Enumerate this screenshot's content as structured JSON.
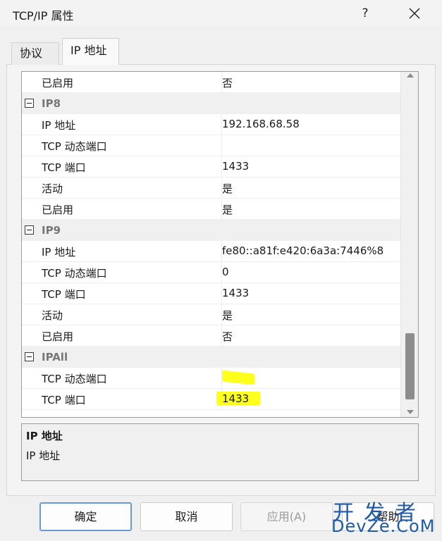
{
  "window": {
    "title": "TCP/IP 属性",
    "help": "?"
  },
  "tabs": [
    {
      "label": "协议"
    },
    {
      "label": "IP 地址"
    }
  ],
  "grid": {
    "rows": [
      {
        "type": "prop",
        "key": "已启用",
        "value": "否"
      },
      {
        "type": "cat",
        "label": "IP8"
      },
      {
        "type": "prop",
        "key": "IP 地址",
        "value": "192.168.68.58"
      },
      {
        "type": "prop",
        "key": "TCP 动态端口",
        "value": ""
      },
      {
        "type": "prop",
        "key": "TCP 端口",
        "value": "1433"
      },
      {
        "type": "prop",
        "key": "活动",
        "value": "是"
      },
      {
        "type": "prop",
        "key": "已启用",
        "value": "是"
      },
      {
        "type": "cat",
        "label": "IP9"
      },
      {
        "type": "prop",
        "key": "IP 地址",
        "value": "fe80::a81f:e420:6a3a:7446%8"
      },
      {
        "type": "prop",
        "key": "TCP 动态端口",
        "value": "0"
      },
      {
        "type": "prop",
        "key": "TCP 端口",
        "value": "1433"
      },
      {
        "type": "prop",
        "key": "活动",
        "value": "是"
      },
      {
        "type": "prop",
        "key": "已启用",
        "value": "否"
      },
      {
        "type": "cat",
        "label": "IPAll"
      },
      {
        "type": "prop",
        "key": "TCP 动态端口",
        "value": ""
      },
      {
        "type": "prop",
        "key": "TCP 端口",
        "value": "1433"
      }
    ]
  },
  "description": {
    "title": "IP 地址",
    "text": "IP 地址"
  },
  "buttons": {
    "ok": "确定",
    "cancel": "取消",
    "apply": "应用(A)",
    "help": "帮助"
  },
  "watermark": {
    "cn": "开发者",
    "en": "DevZe.CoM"
  },
  "colors": {
    "highlight": "#ffff1e",
    "watermark": "#1f5aa8"
  }
}
